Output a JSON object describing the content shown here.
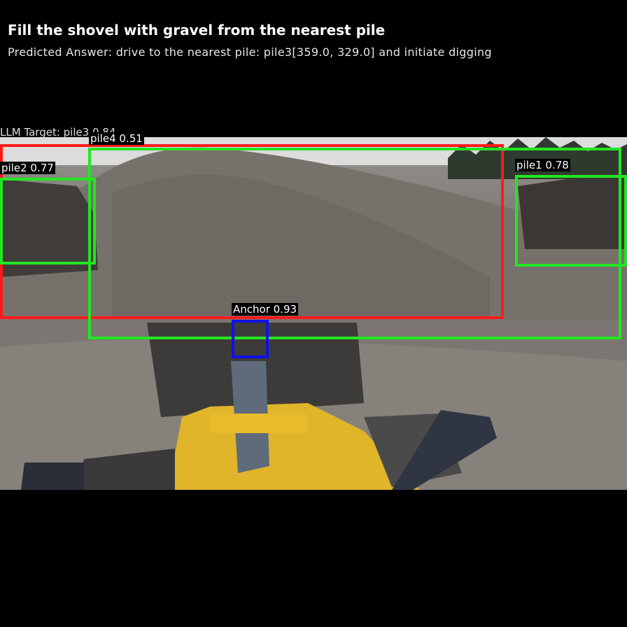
{
  "header": {
    "title": "Fill the shovel with gravel from the nearest pile",
    "prediction": "Predicted Answer: drive to the nearest pile: pile3[359.0, 329.0] and initiate digging"
  },
  "overlay": {
    "llm_target": "LLM Target: pile3 0.84"
  },
  "detections": [
    {
      "label": "pile4 0.51",
      "color": "#ff1a1a"
    },
    {
      "label": "pile2 0.77",
      "color": "#22e622"
    },
    {
      "label": "pile1 0.78",
      "color": "#22e622"
    },
    {
      "label": "Anchor 0.93",
      "color": "#1010e6"
    }
  ],
  "colors": {
    "background": "#000000",
    "red_box": "#ff1a1a",
    "green_box": "#22e622",
    "blue_box": "#1010e6"
  }
}
